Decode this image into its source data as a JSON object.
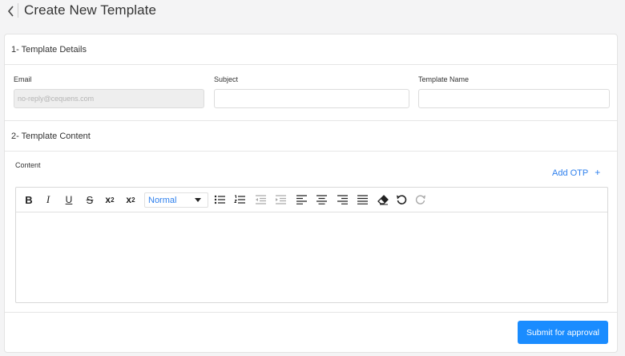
{
  "header": {
    "title": "Create New Template",
    "back_icon": "chevron-left-icon"
  },
  "details_section": {
    "title": "1- Template Details",
    "email": {
      "label": "Email",
      "placeholder": "no-reply@cequens.com",
      "value": ""
    },
    "subject": {
      "label": "Subject",
      "value": ""
    },
    "template_name": {
      "label": "Template Name",
      "value": ""
    }
  },
  "content_section": {
    "title": "2- Template Content",
    "content_label": "Content",
    "add_otp": {
      "label": "Add OTP",
      "icon": "+"
    }
  },
  "toolbar": {
    "bold": "B",
    "italic": "I",
    "underline": "U",
    "strike": "S",
    "superscript_base": "x",
    "superscript_mark": "2",
    "subscript_base": "x",
    "subscript_mark": "2",
    "format_value": "Normal",
    "icons": [
      "bold-icon",
      "italic-icon",
      "underline-icon",
      "strike-icon",
      "superscript-icon",
      "subscript-icon",
      "bullet-list-icon",
      "ordered-list-icon",
      "outdent-icon",
      "indent-icon",
      "align-left-icon",
      "align-center-icon",
      "align-right-icon",
      "align-justify-icon",
      "clear-format-icon",
      "undo-icon",
      "redo-icon"
    ]
  },
  "actions": {
    "submit_label": "Submit for approval"
  },
  "colors": {
    "accent": "#1a8cff",
    "link": "#2f80ed",
    "background": "#f4f4f5"
  }
}
